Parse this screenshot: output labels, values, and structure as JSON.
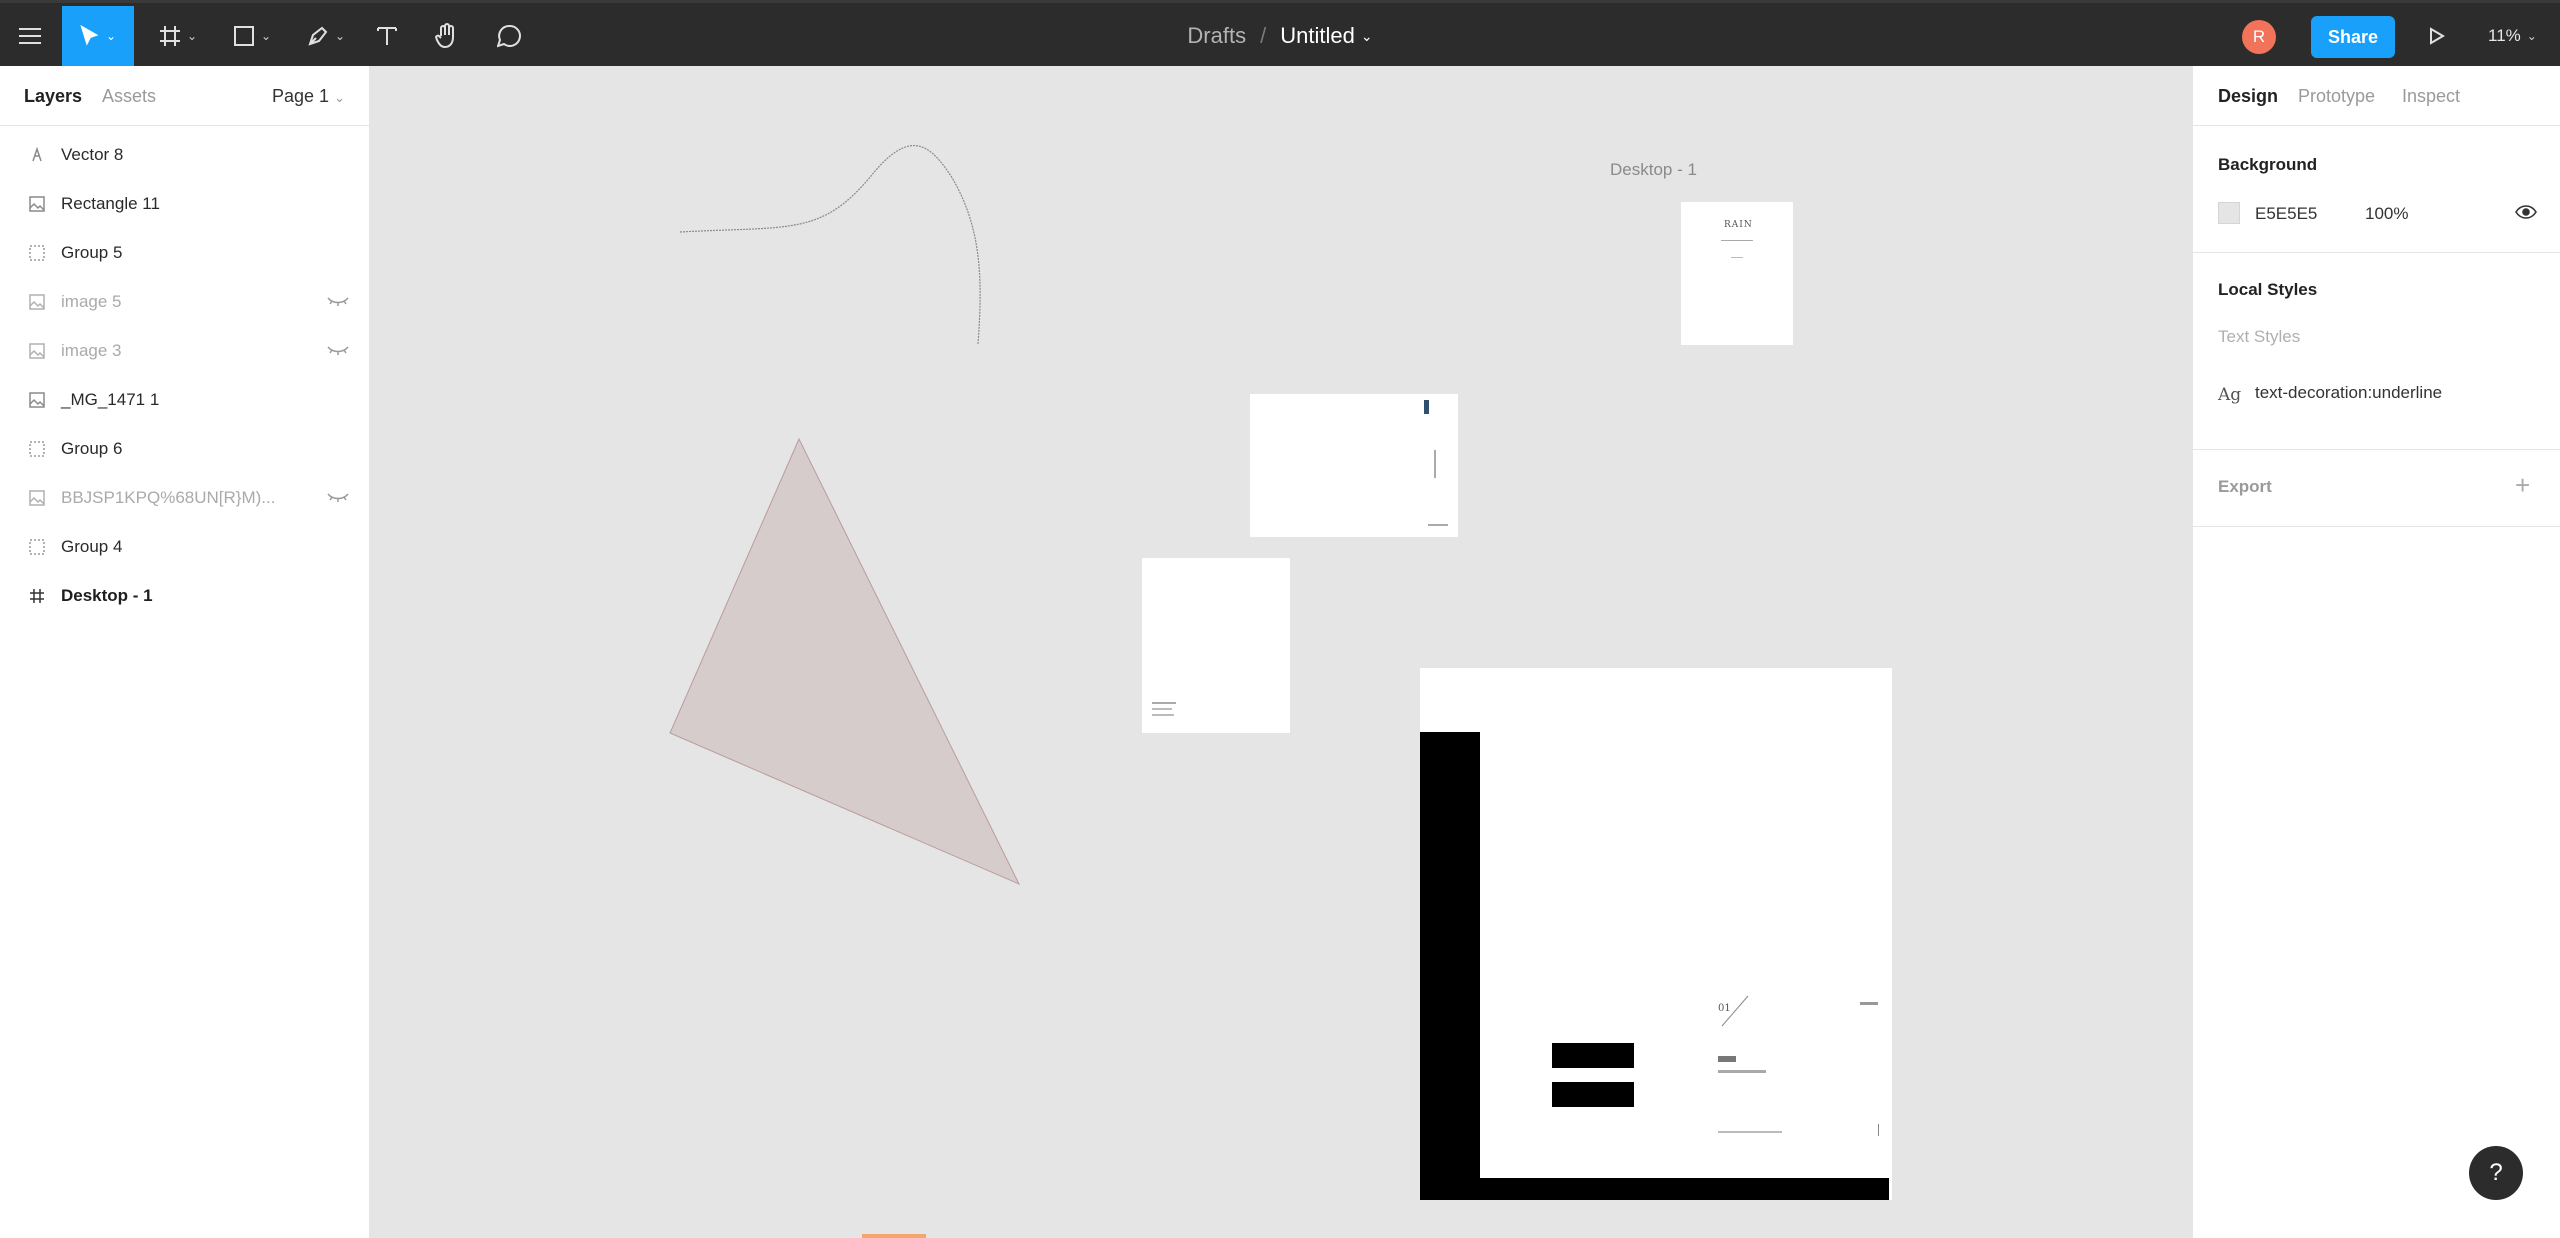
{
  "toolbar": {
    "menu_icon": "hamburger-icon",
    "tools": [
      "move-tool",
      "frame-tool",
      "shape-tool",
      "pen-tool",
      "text-tool",
      "hand-tool",
      "comment-tool"
    ],
    "breadcrumb": "Drafts",
    "separator": "/",
    "title": "Untitled",
    "avatar_initial": "R",
    "share_label": "Share",
    "zoom": "11%",
    "accent_color": "#18a0fb"
  },
  "left_panel": {
    "tabs": [
      "Layers",
      "Assets"
    ],
    "page": "Page 1",
    "layers": [
      {
        "name": "Vector 8",
        "icon": "vector-icon",
        "hidden": false
      },
      {
        "name": "Rectangle 11",
        "icon": "image-icon",
        "hidden": false
      },
      {
        "name": "Group 5",
        "icon": "group-icon",
        "hidden": false
      },
      {
        "name": "image 5",
        "icon": "image-icon",
        "hidden": true
      },
      {
        "name": "image 3",
        "icon": "image-icon",
        "hidden": true
      },
      {
        "name": "_MG_1471 1",
        "icon": "image-icon",
        "hidden": false
      },
      {
        "name": "Group 6",
        "icon": "group-icon",
        "hidden": false
      },
      {
        "name": "BBJSP1KPQ%68UN[R}M)...",
        "icon": "image-icon",
        "hidden": true
      },
      {
        "name": "Group 4",
        "icon": "group-icon",
        "hidden": false
      },
      {
        "name": "Desktop - 1",
        "icon": "frame-icon",
        "hidden": false
      }
    ]
  },
  "right_panel": {
    "tabs": [
      "Design",
      "Prototype",
      "Inspect"
    ],
    "background": {
      "heading": "Background",
      "hex": "E5E5E5",
      "opacity": "100%"
    },
    "local_styles": {
      "heading": "Local Styles",
      "subheading": "Text Styles",
      "style_prefix": "Ag",
      "style_name": "text-decoration:underline"
    },
    "export": {
      "heading": "Export",
      "add": "+"
    }
  },
  "canvas": {
    "frame_label": "Desktop - 1",
    "poster_title": "RAIN",
    "poster2_num": "01",
    "triangle_color": "#d7cccc"
  },
  "help_label": "?"
}
